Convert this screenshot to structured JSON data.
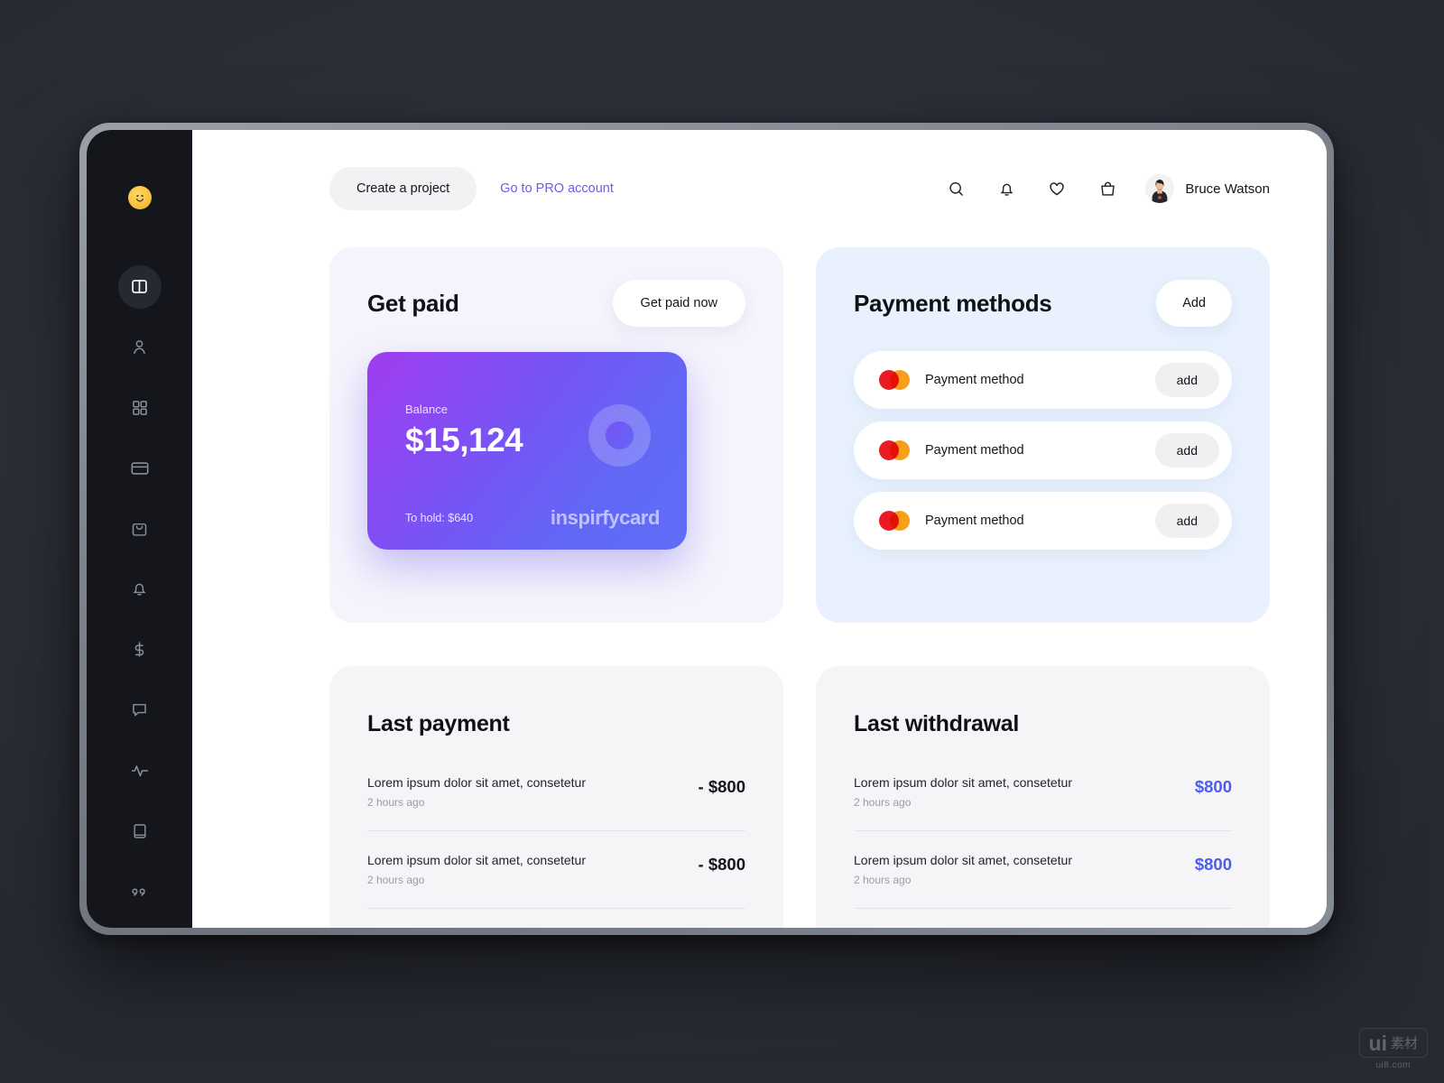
{
  "sidebar": {
    "logo_icon": "smiley-face-logo",
    "items": [
      {
        "icon": "layout-columns-icon",
        "name": "dashboard",
        "active": true
      },
      {
        "icon": "user-icon",
        "name": "profile",
        "active": false
      },
      {
        "icon": "grid-icon",
        "name": "apps",
        "active": false
      },
      {
        "icon": "credit-card-icon",
        "name": "cards",
        "active": false
      },
      {
        "icon": "shopping-bag-icon",
        "name": "shop",
        "active": false
      },
      {
        "icon": "bell-icon",
        "name": "notifications",
        "active": false
      },
      {
        "icon": "dollar-icon",
        "name": "payments",
        "active": false
      },
      {
        "icon": "chat-bubble-icon",
        "name": "messages",
        "active": false
      },
      {
        "icon": "activity-pulse-icon",
        "name": "activity",
        "active": false
      },
      {
        "icon": "book-icon",
        "name": "docs",
        "active": false
      },
      {
        "icon": "quote-icon",
        "name": "quotes",
        "active": false
      }
    ]
  },
  "header": {
    "create_label": "Create a project",
    "pro_link_label": "Go to PRO account",
    "pro_link_color": "#6a5cf0",
    "icons": [
      "search-icon",
      "bell-icon",
      "heart-icon",
      "shopping-bag-icon"
    ],
    "user_name": "Bruce Watson"
  },
  "get_paid": {
    "title": "Get paid",
    "action_label": "Get paid now",
    "panel_color": "#f5f4fc",
    "card": {
      "balance_label": "Balance",
      "balance_amount": "$15,124",
      "hold_label": "To hold: $640",
      "brand": "inspirfycard",
      "gradient_from": "#a03cf0",
      "gradient_to": "#5f6ef7"
    }
  },
  "payment_methods": {
    "title": "Payment methods",
    "action_label": "Add",
    "panel_color": "#e8f1fd",
    "rows": [
      {
        "logo": "mastercard-icon",
        "label": "Payment method",
        "action": "add"
      },
      {
        "logo": "mastercard-icon",
        "label": "Payment method",
        "action": "add"
      },
      {
        "logo": "mastercard-icon",
        "label": "Payment method",
        "action": "add"
      }
    ]
  },
  "last_payment": {
    "title": "Last payment",
    "rows": [
      {
        "desc": "Lorem ipsum dolor sit amet, consetetur",
        "time": "2 hours ago",
        "amount": "- $800"
      },
      {
        "desc": "Lorem ipsum dolor sit amet, consetetur",
        "time": "2 hours ago",
        "amount": "- $800"
      }
    ]
  },
  "last_withdrawal": {
    "title": "Last withdrawal",
    "amount_color": "#4a5df0",
    "rows": [
      {
        "desc": "Lorem ipsum dolor sit amet, consetetur",
        "time": "2 hours ago",
        "amount": "$800"
      },
      {
        "desc": "Lorem ipsum dolor sit amet, consetetur",
        "time": "2 hours ago",
        "amount": "$800"
      }
    ]
  },
  "watermark": {
    "brand": "ui",
    "cjk": "素材",
    "url": "ui8.com"
  }
}
